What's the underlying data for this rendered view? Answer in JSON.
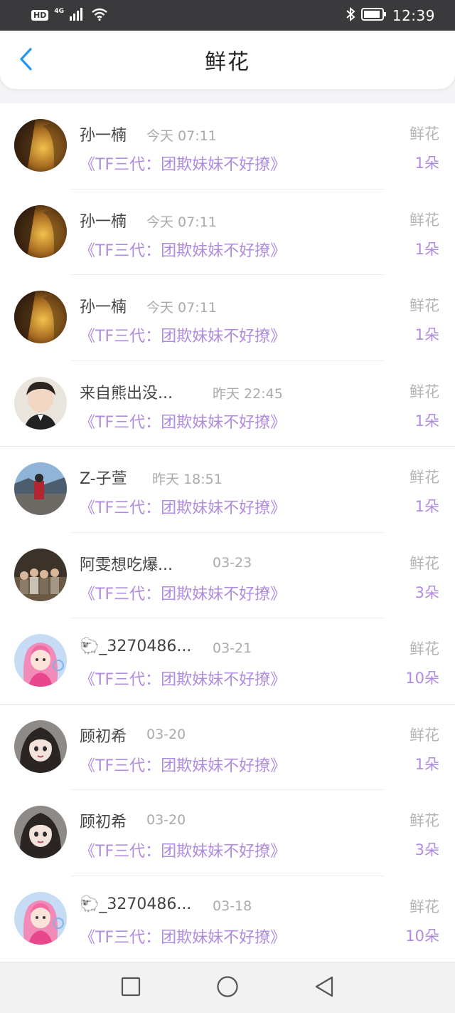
{
  "status_bar": {
    "hd": "HD",
    "network": "4G",
    "time": "12:39"
  },
  "header": {
    "title": "鲜花",
    "back_icon": "chevron-left-icon"
  },
  "colors": {
    "accent": "#b08be0",
    "back": "#2196f3",
    "status_bar": "#3a3a3c"
  },
  "records": [
    {
      "name": "孙一楠",
      "time": "今天 07:11",
      "book": "《TF三代：团欺妹妹不好撩》",
      "type": "鲜花",
      "count": "1朵",
      "avatar": "avatar-warm-portrait"
    },
    {
      "name": "孙一楠",
      "time": "今天 07:11",
      "book": "《TF三代：团欺妹妹不好撩》",
      "type": "鲜花",
      "count": "1朵",
      "avatar": "avatar-warm-portrait"
    },
    {
      "name": "孙一楠",
      "time": "今天 07:11",
      "book": "《TF三代：团欺妹妹不好撩》",
      "type": "鲜花",
      "count": "1朵",
      "avatar": "avatar-warm-portrait"
    },
    {
      "name": "来自熊出没...",
      "time": "昨天 22:45",
      "book": "《TF三代：团欺妹妹不好撩》",
      "type": "鲜花",
      "count": "1朵",
      "avatar": "avatar-boy-portrait"
    },
    {
      "name": "Z-子萱",
      "time": "昨天 18:51",
      "book": "《TF三代：团欺妹妹不好撩》",
      "type": "鲜花",
      "count": "1朵",
      "avatar": "avatar-scenery"
    },
    {
      "name": "阿雯想吃爆...",
      "time": "03-23",
      "book": "《TF三代：团欺妹妹不好撩》",
      "type": "鲜花",
      "count": "3朵",
      "avatar": "avatar-group-photo"
    },
    {
      "name": "🐑_3270486...",
      "time": "03-21",
      "book": "《TF三代：团欺妹妹不好撩》",
      "type": "鲜花",
      "count": "10朵",
      "avatar": "avatar-pink-cartoon"
    },
    {
      "name": "顾初希",
      "time": "03-20",
      "book": "《TF三代：团欺妹妹不好撩》",
      "type": "鲜花",
      "count": "1朵",
      "avatar": "avatar-dark-cartoon"
    },
    {
      "name": "顾初希",
      "time": "03-20",
      "book": "《TF三代：团欺妹妹不好撩》",
      "type": "鲜花",
      "count": "3朵",
      "avatar": "avatar-dark-cartoon"
    },
    {
      "name": "🐑_3270486...",
      "time": "03-18",
      "book": "《TF三代：团欺妹妹不好撩》",
      "type": "鲜花",
      "count": "10朵",
      "avatar": "avatar-pink-cartoon"
    }
  ],
  "nav": {
    "recent_icon": "square-icon",
    "home_icon": "circle-icon",
    "back_icon": "triangle-back-icon"
  }
}
